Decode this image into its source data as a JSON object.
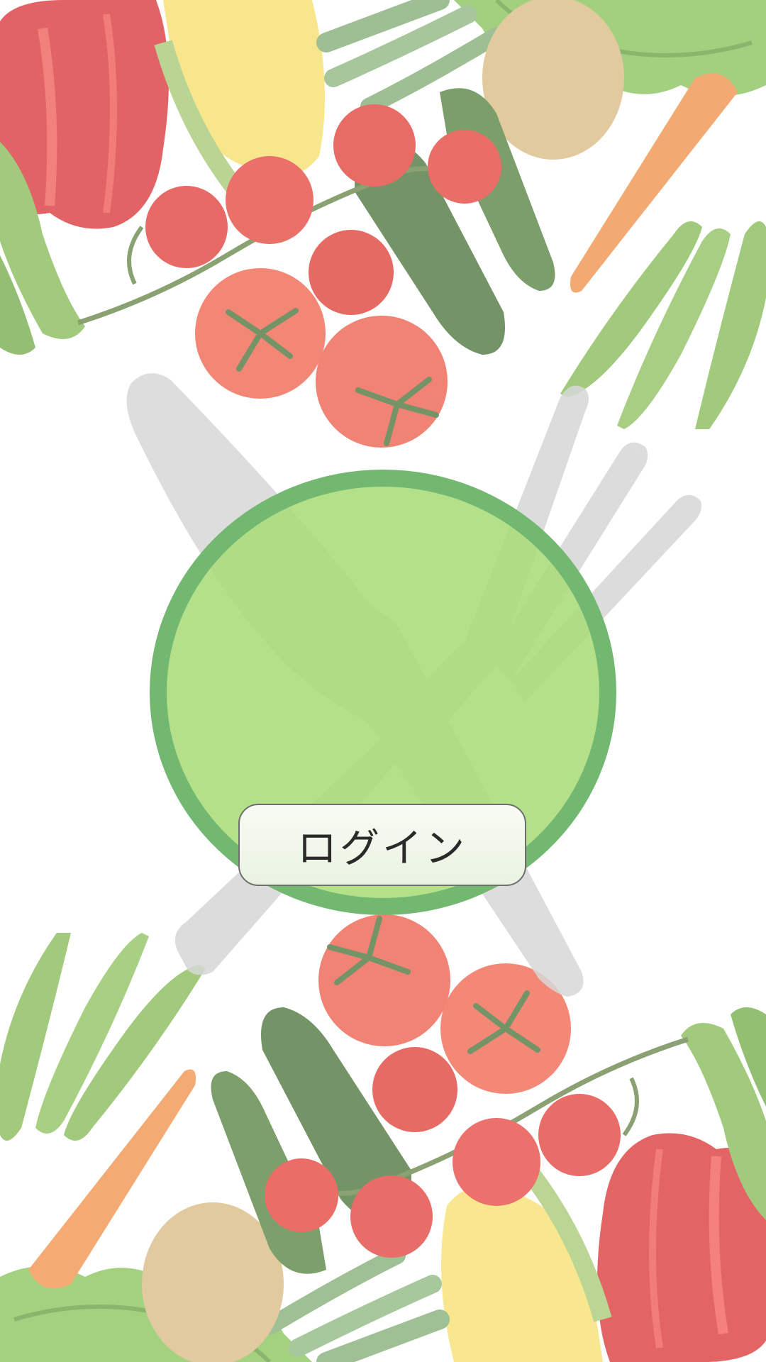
{
  "login_screen": {
    "login_button_label": "ログイン"
  },
  "background": {
    "theme": "fresh vegetables",
    "watermark_icon": "knife-fork-icon"
  },
  "colors": {
    "circle_fill": "#a8dc78",
    "circle_border": "#6cb570",
    "button_fill": "#f1f7ec",
    "button_border": "#6f6f6f",
    "button_text": "#2a2a2a",
    "watermark": "#d7d7d7"
  }
}
